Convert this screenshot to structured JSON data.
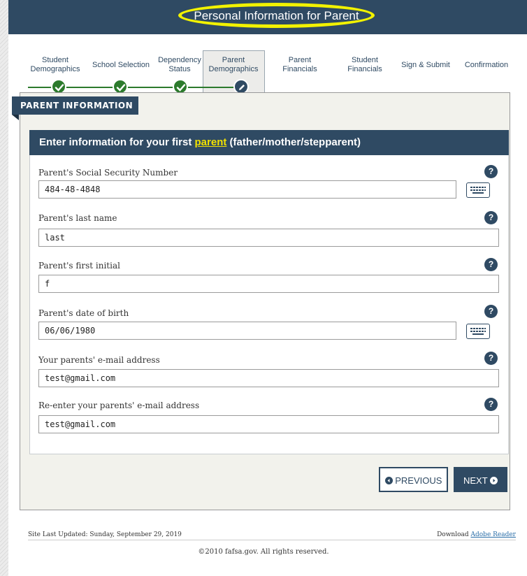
{
  "header": {
    "title": "Personal Information for Parent"
  },
  "steps": [
    {
      "line1": "Student",
      "line2": "Demographics",
      "status": "done"
    },
    {
      "line1": "School Selection",
      "line2": "",
      "status": "done"
    },
    {
      "line1": "Dependency",
      "line2": "Status",
      "status": "done"
    },
    {
      "line1": "Parent",
      "line2": "Demographics",
      "status": "current"
    },
    {
      "line1": "Parent",
      "line2": "Financials",
      "status": "todo"
    },
    {
      "line1": "Student",
      "line2": "Financials",
      "status": "todo"
    },
    {
      "line1": "Sign & Submit",
      "line2": "",
      "status": "todo"
    },
    {
      "line1": "Confirmation",
      "line2": "",
      "status": "todo"
    }
  ],
  "section_tab": "PARENT INFORMATION",
  "card": {
    "heading_pre": "Enter information for your first ",
    "heading_link": "parent",
    "heading_post": " (father/mother/stepparent)"
  },
  "fields": [
    {
      "label": "Parent's Social Security Number",
      "value": "484-48-4848",
      "keyboard": true
    },
    {
      "label": "Parent's last name",
      "value": "last",
      "keyboard": false
    },
    {
      "label": "Parent's first initial",
      "value": "f",
      "keyboard": false
    },
    {
      "label": "Parent's date of birth",
      "value": "06/06/1980",
      "keyboard": true
    },
    {
      "label": "Your parents' e-mail address",
      "value": "test@gmail.com",
      "keyboard": false
    },
    {
      "label": "Re-enter your parents' e-mail address",
      "value": "test@gmail.com",
      "keyboard": false
    }
  ],
  "help_glyph": "?",
  "buttons": {
    "previous": "PREVIOUS",
    "next": "NEXT"
  },
  "footer": {
    "updated": "Site Last Updated: Sunday, September 29, 2019",
    "download_prefix": "Download ",
    "download_link": "Adobe Reader",
    "copyright": "©2010 fafsa.gov. All rights reserved."
  },
  "colors": {
    "brand_navy": "#2f4a63",
    "complete_green": "#2c7a2c",
    "highlight": "#f2e200"
  }
}
